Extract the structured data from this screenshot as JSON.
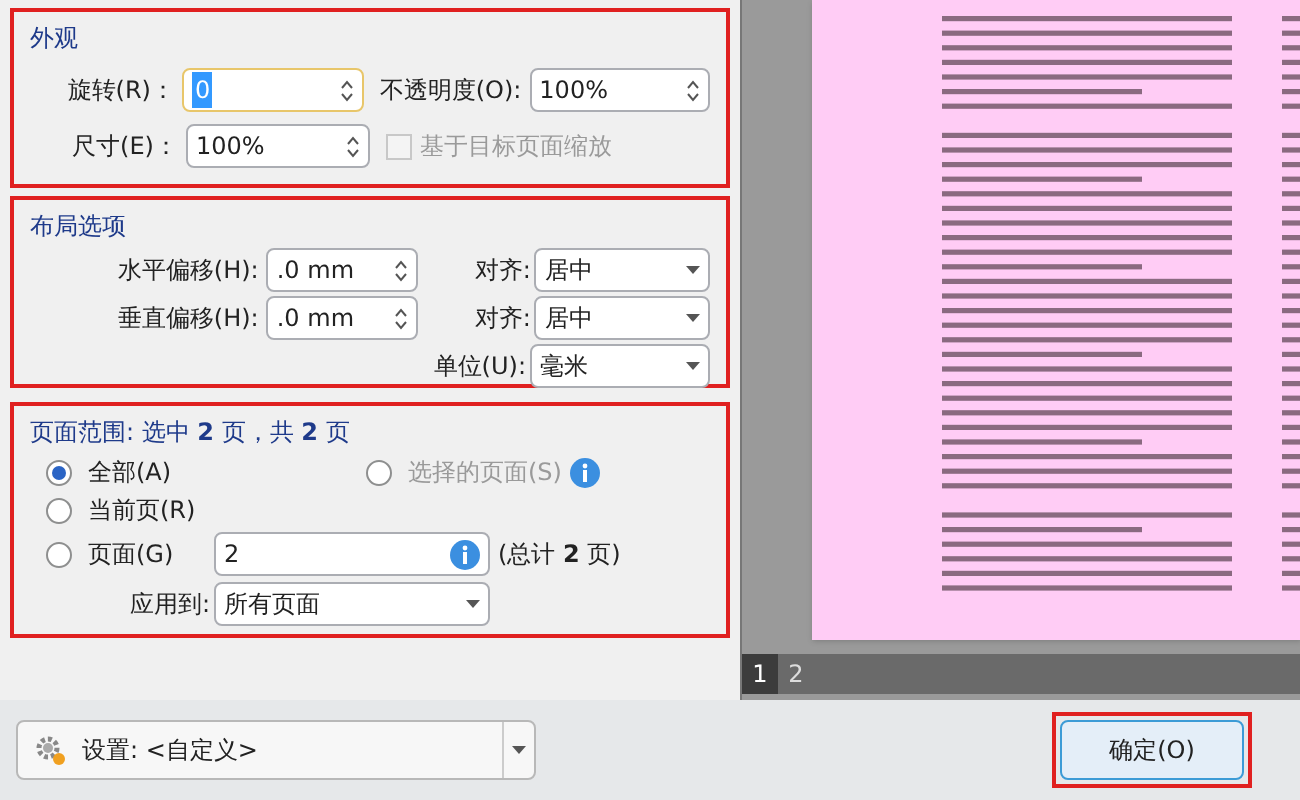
{
  "appearance": {
    "title": "外观",
    "rotation": {
      "label": "旋转(R)：",
      "value": "0"
    },
    "opacity": {
      "label": "不透明度(O):",
      "value": "100%"
    },
    "size": {
      "label": "尺寸(E)：",
      "value": "100%"
    },
    "fit_to_page": {
      "label": "基于目标页面缩放",
      "checked": false,
      "disabled": true
    }
  },
  "layout": {
    "title": "布局选项",
    "rows": [
      {
        "label": "水平偏移(H):",
        "value": ".0 mm",
        "align_label": "对齐:",
        "align_value": "居中"
      },
      {
        "label": "垂直偏移(H):",
        "value": ".0 mm",
        "align_label": "对齐:",
        "align_value": "居中"
      }
    ],
    "unit": {
      "label": "单位(U):",
      "value": "毫米"
    }
  },
  "page_range": {
    "title": "页面范围: 选中 **2** 页，共 **2** 页",
    "options": [
      {
        "label": "全部(A)",
        "selected": true,
        "disabled": false
      },
      {
        "label": "选择的页面(S)",
        "selected": false,
        "disabled": true
      },
      {
        "label": "当前页(R)",
        "selected": false,
        "disabled": false
      },
      {
        "label": "页面(G)",
        "selected": false,
        "disabled": false
      }
    ],
    "pages_value": "2",
    "total": "(总计 **2** 页)",
    "apply_to": {
      "label": "应用到:",
      "value": "所有页面"
    }
  },
  "preview": {
    "page_tabs": [
      {
        "label": "1",
        "selected": true
      },
      {
        "label": "2",
        "selected": false
      }
    ]
  },
  "settings": {
    "label": "设置: <自定义>"
  },
  "ok_button": "确定(O)"
}
